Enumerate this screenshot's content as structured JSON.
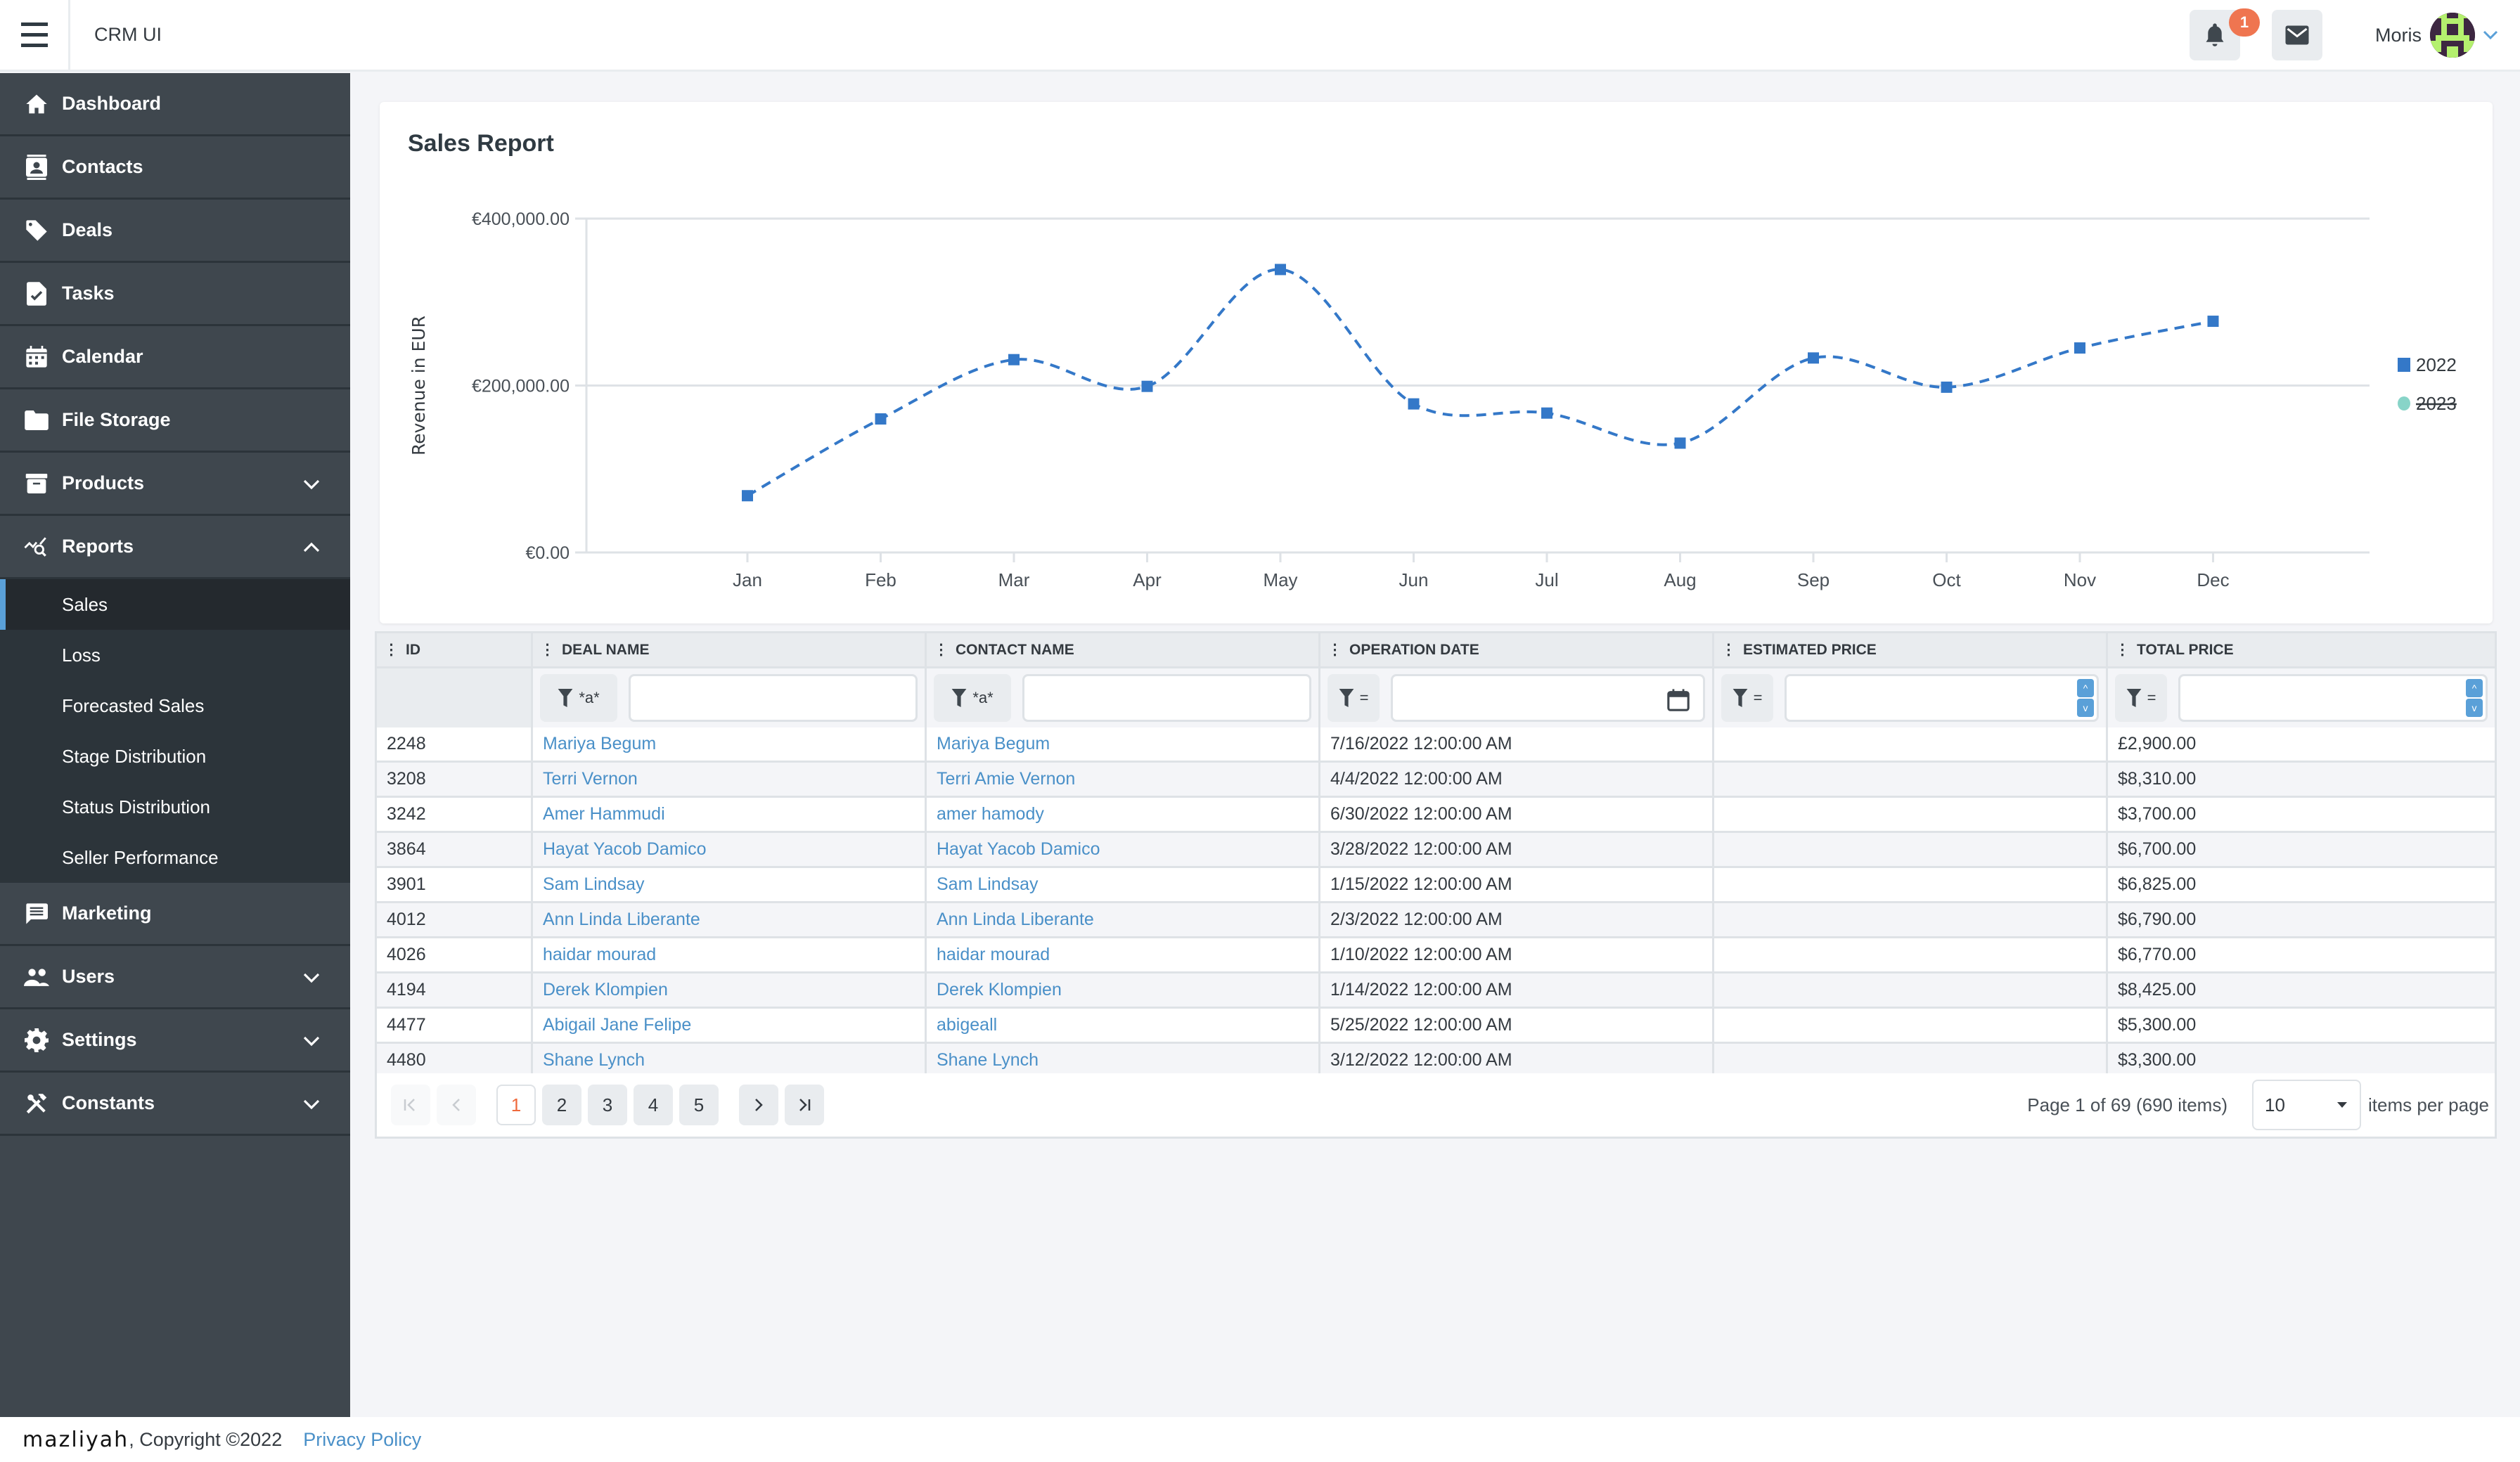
{
  "header": {
    "app_title": "CRM UI",
    "notification_count": "1",
    "user_name": "Moris"
  },
  "sidebar": {
    "items": [
      {
        "label": "Dashboard",
        "icon": "home-icon"
      },
      {
        "label": "Contacts",
        "icon": "contacts-icon"
      },
      {
        "label": "Deals",
        "icon": "tag-icon"
      },
      {
        "label": "Tasks",
        "icon": "task-icon"
      },
      {
        "label": "Calendar",
        "icon": "calendar-icon"
      },
      {
        "label": "File Storage",
        "icon": "folder-icon"
      },
      {
        "label": "Products",
        "icon": "archive-icon",
        "expandable": true,
        "expanded": false
      },
      {
        "label": "Reports",
        "icon": "report-icon",
        "expandable": true,
        "expanded": true
      },
      {
        "label": "Marketing",
        "icon": "message-icon"
      },
      {
        "label": "Users",
        "icon": "users-icon",
        "expandable": true,
        "expanded": false
      },
      {
        "label": "Settings",
        "icon": "gear-icon",
        "expandable": true,
        "expanded": false
      },
      {
        "label": "Constants",
        "icon": "tools-icon",
        "expandable": true,
        "expanded": false
      }
    ],
    "reports_submenu": [
      {
        "label": "Sales",
        "active": true
      },
      {
        "label": "Loss"
      },
      {
        "label": "Forecasted Sales"
      },
      {
        "label": "Stage Distribution"
      },
      {
        "label": "Status Distribution"
      },
      {
        "label": "Seller Performance"
      }
    ]
  },
  "report": {
    "title": "Sales Report"
  },
  "chart_data": {
    "type": "line",
    "title": "Sales Report",
    "xlabel": "",
    "ylabel": "Revenue in EUR",
    "categories": [
      "Jan",
      "Feb",
      "Mar",
      "Apr",
      "May",
      "Jun",
      "Jul",
      "Aug",
      "Sep",
      "Oct",
      "Nov",
      "Dec"
    ],
    "ylim": [
      0,
      400000
    ],
    "yticks": [
      0,
      200000,
      400000
    ],
    "ytick_labels": [
      "€0.00",
      "€200,000.00",
      "€400,000.00"
    ],
    "grid": true,
    "legend_position": "right",
    "series": [
      {
        "name": "2022",
        "color": "#3478c8",
        "marker": "square",
        "line": "dashed",
        "visible": true,
        "values": [
          68000,
          160000,
          231000,
          199000,
          339000,
          178000,
          167000,
          131000,
          233000,
          198000,
          245000,
          277000
        ]
      },
      {
        "name": "2023",
        "color": "#88d4c8",
        "marker": "circle",
        "visible": false,
        "values": []
      }
    ]
  },
  "grid": {
    "columns": [
      "ID",
      "Deal Name",
      "Contact Name",
      "Operation Date",
      "Estimated Price",
      "Total Price"
    ],
    "filters": [
      null,
      {
        "operator": "*a*",
        "value": ""
      },
      {
        "operator": "*a*",
        "value": ""
      },
      {
        "operator": "=",
        "value": ""
      },
      {
        "operator": "=",
        "value": ""
      },
      {
        "operator": "=",
        "value": ""
      }
    ],
    "rows": [
      {
        "id": "2248",
        "deal": "Mariya Begum",
        "contact": "Mariya Begum",
        "date": "7/16/2022 12:00:00 AM",
        "estimated": "",
        "total": "£2,900.00"
      },
      {
        "id": "3208",
        "deal": "Terri Vernon",
        "contact": "Terri Amie Vernon",
        "date": "4/4/2022 12:00:00 AM",
        "estimated": "",
        "total": "$8,310.00"
      },
      {
        "id": "3242",
        "deal": "Amer Hammudi",
        "contact": "amer hamody",
        "date": "6/30/2022 12:00:00 AM",
        "estimated": "",
        "total": "$3,700.00"
      },
      {
        "id": "3864",
        "deal": "Hayat Yacob Damico",
        "contact": "Hayat Yacob Damico",
        "date": "3/28/2022 12:00:00 AM",
        "estimated": "",
        "total": "$6,700.00"
      },
      {
        "id": "3901",
        "deal": "Sam Lindsay",
        "contact": "Sam Lindsay",
        "date": "1/15/2022 12:00:00 AM",
        "estimated": "",
        "total": "$6,825.00"
      },
      {
        "id": "4012",
        "deal": "Ann Linda Liberante",
        "contact": "Ann Linda Liberante",
        "date": "2/3/2022 12:00:00 AM",
        "estimated": "",
        "total": "$6,790.00"
      },
      {
        "id": "4026",
        "deal": "haidar mourad",
        "contact": "haidar mourad",
        "date": "1/10/2022 12:00:00 AM",
        "estimated": "",
        "total": "$6,770.00"
      },
      {
        "id": "4194",
        "deal": "Derek Klompien",
        "contact": "Derek Klompien",
        "date": "1/14/2022 12:00:00 AM",
        "estimated": "",
        "total": "$8,425.00"
      },
      {
        "id": "4477",
        "deal": "Abigail Jane Felipe",
        "contact": "abigeall",
        "date": "5/25/2022 12:00:00 AM",
        "estimated": "",
        "total": "$5,300.00"
      },
      {
        "id": "4480",
        "deal": "Shane Lynch",
        "contact": "Shane Lynch",
        "date": "3/12/2022 12:00:00 AM",
        "estimated": "",
        "total": "$3,300.00"
      }
    ]
  },
  "pager": {
    "pages": [
      "1",
      "2",
      "3",
      "4",
      "5"
    ],
    "current_page": "1",
    "info": "Page 1 of 69 (690 items)",
    "page_size": "10",
    "page_size_suffix": "items per page"
  },
  "footer": {
    "brand": "mazliyah",
    "copyright": ", Copyright ©2022",
    "privacy_link": "Privacy Policy"
  }
}
